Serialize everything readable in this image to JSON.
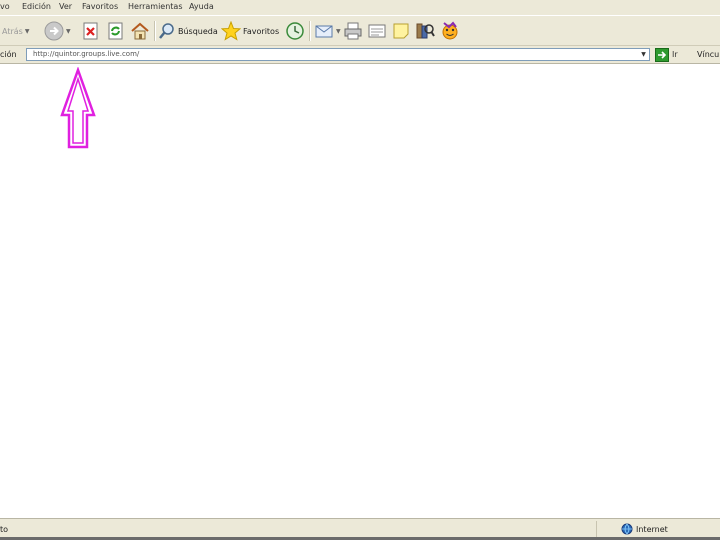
{
  "menu": {
    "items": [
      "vo",
      "Edición",
      "Ver",
      "Favoritos",
      "Herramientas",
      "Ayuda"
    ]
  },
  "toolbar": {
    "back_label": "Atrás",
    "search_label": "Búsqueda",
    "favorites_label": "Favoritos"
  },
  "address": {
    "label": "ción",
    "url": "http://quintor.groups.live.com/",
    "go_label": "Ir",
    "links_label": "Vínculo"
  },
  "status": {
    "text": "to",
    "zone_label": "Internet"
  },
  "icons": {
    "annotation_arrow": "up-arrow-outline",
    "arrow_color": "#e020e0"
  }
}
